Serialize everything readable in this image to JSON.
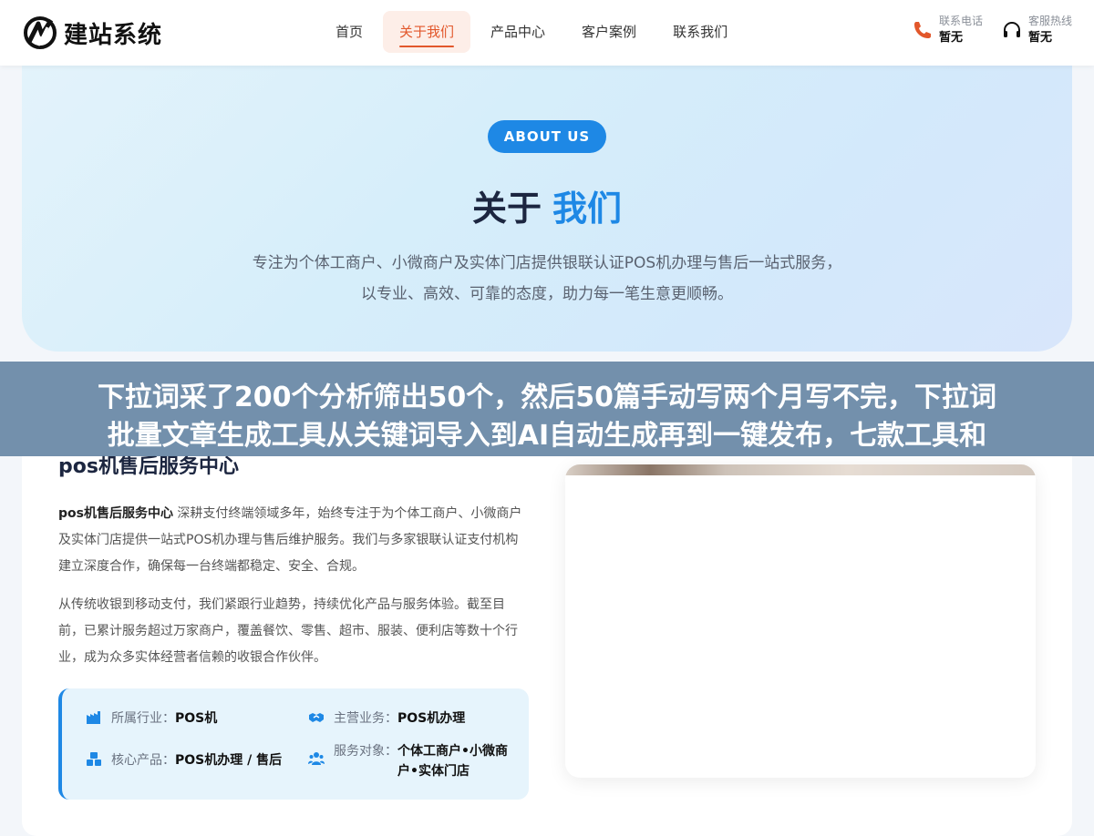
{
  "header": {
    "logo_text": "建站系统",
    "nav": [
      "首页",
      "关于我们",
      "产品中心",
      "客户案例",
      "联系我们"
    ],
    "active_nav": 1,
    "contact_phone": {
      "label": "联系电话",
      "value": "暂无"
    },
    "contact_service": {
      "label": "客服热线",
      "value": "暂无"
    }
  },
  "hero": {
    "badge": "ABOUT US",
    "title_part1": "关于",
    "title_part2": "我们",
    "desc_line1": "专注为个体工商户、小微商户及实体门店提供银联认证POS机办理与售后一站式服务，",
    "desc_line2": "以专业、高效、可靠的态度，助力每一笔生意更顺畅。"
  },
  "banner": {
    "line1": "下拉词采了200个分析筛出50个，然后50篇手动写两个月写不完，下拉词",
    "line2": "批量文章生成工具从关键词导入到AI自动生成再到一键发布，七款工具和"
  },
  "about": {
    "title": "pos机售后服务中心",
    "p1_strong": "pos机售后服务中心",
    "p1_text": " 深耕支付终端领域多年，始终专注于为个体工商户、小微商户及实体门店提供一站式POS机办理与售后维护服务。我们与多家银联认证支付机构建立深度合作，确保每一台终端都稳定、安全、合规。",
    "p2_text": "从传统收银到移动支付，我们紧跟行业趋势，持续优化产品与服务体验。截至目前，已累计服务超过万家商户，覆盖餐饮、零售、超市、服装、便利店等数十个行业，成为众多实体经营者信赖的收银合作伙伴。",
    "info": {
      "industry_label": "所属行业：",
      "industry_value": "POS机",
      "business_label": "主营业务：",
      "business_value": "POS机办理",
      "product_label": "核心产品：",
      "product_value": "POS机办理 / 售后",
      "target_label": "服务对象：",
      "target_value": "个体工商户•小微商户•实体门店"
    }
  },
  "colors": {
    "accent": "#1e88e5",
    "nav_active": "#e2572b",
    "banner": "#6888a6"
  }
}
